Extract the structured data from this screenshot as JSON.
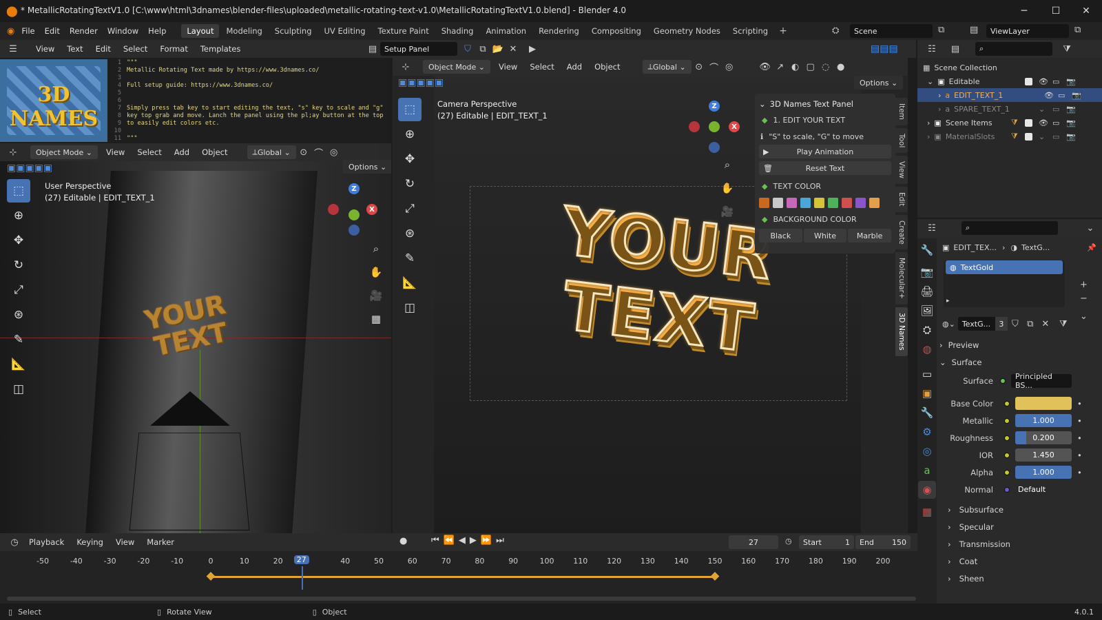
{
  "window": {
    "title": "* MetallicRotatingTextV1.0 [C:\\www\\html\\3dnames\\blender-files\\uploaded\\metallic-rotating-text-v1.0\\MetallicRotatingTextV1.0.blend] - Blender 4.0"
  },
  "menu": [
    "File",
    "Edit",
    "Render",
    "Window",
    "Help"
  ],
  "workspaces": [
    "Layout",
    "Modeling",
    "Sculpting",
    "UV Editing",
    "Texture Paint",
    "Shading",
    "Animation",
    "Rendering",
    "Compositing",
    "Geometry Nodes",
    "Scripting"
  ],
  "active_workspace": "Layout",
  "scene": {
    "name": "Scene",
    "view_layer": "ViewLayer"
  },
  "text_editor": {
    "menus": [
      "View",
      "Text",
      "Edit",
      "Select",
      "Format",
      "Templates"
    ],
    "file": "Setup Panel",
    "lines": [
      {
        "n": "1",
        "t": "\"\"\""
      },
      {
        "n": "2",
        "t": "Metallic Rotating Text made by https://www.3dnames.co/"
      },
      {
        "n": "3",
        "t": ""
      },
      {
        "n": "4",
        "t": "Full setup guide: https://www.3dnames.co/"
      },
      {
        "n": "5",
        "t": ""
      },
      {
        "n": "6",
        "t": ""
      },
      {
        "n": "7",
        "t": "Simply press tab key to start editing the text, \"s\" key to scale and \"g\""
      },
      {
        "n": "8",
        "t": "key top grab and move. Lanch the panel using the pl;ay button at the top"
      },
      {
        "n": "9",
        "t": "to easily edit colors etc."
      },
      {
        "n": "10",
        "t": ""
      },
      {
        "n": "11",
        "t": "\"\"\""
      }
    ],
    "logo_text": "3D NAMES"
  },
  "viewport_left": {
    "mode": "Object Mode",
    "menus": [
      "View",
      "Select",
      "Add",
      "Object"
    ],
    "orientation": "Global",
    "options": "Options",
    "perspective": "User Perspective",
    "info": "(27) Editable | EDIT_TEXT_1"
  },
  "viewport_right": {
    "mode": "Object Mode",
    "menus": [
      "View",
      "Select",
      "Add",
      "Object"
    ],
    "orientation": "Global",
    "options": "Options",
    "perspective": "Camera Perspective",
    "info": "(27) Editable | EDIT_TEXT_1",
    "render_text": "YOUR TEXT",
    "sidebar_tabs": [
      "Item",
      "Tool",
      "View",
      "Edit",
      "Create",
      "Molecular+",
      "3D Names"
    ]
  },
  "panel": {
    "title": "3D Names Text Panel",
    "step1": "1. EDIT YOUR TEXT",
    "hint": "\"S\" to scale, \"G\" to move",
    "play": "Play Animation",
    "reset": "Reset Text",
    "text_color": "TEXT COLOR",
    "swatches": [
      "#c8691e",
      "#c9c9c9",
      "#c767b8",
      "#4aa6d6",
      "#d6c23a",
      "#4fb25a",
      "#d0504f",
      "#8a55c9",
      "#e3a04a"
    ],
    "bg_color": "BACKGROUND COLOR",
    "bg_options": [
      "Black",
      "White",
      "Marble"
    ]
  },
  "outliner": {
    "root": "Scene Collection",
    "items": [
      {
        "label": "Editable",
        "kind": "collection"
      },
      {
        "label": "EDIT_TEXT_1",
        "kind": "text-object"
      },
      {
        "label": "SPARE_TEXT_1",
        "kind": "text-object"
      },
      {
        "label": "Scene Items",
        "kind": "collection"
      },
      {
        "label": "MaterialSlots",
        "kind": "collection"
      }
    ]
  },
  "properties": {
    "breadcrumb_obj": "EDIT_TEX...",
    "breadcrumb_mat": "TextG...",
    "material_slot": "TextGold",
    "material_name": "TextG...",
    "users": "3",
    "preview": "Preview",
    "surface_section": "Surface",
    "surface_label": "Surface",
    "surface_value": "Principled BS...",
    "rows": [
      {
        "label": "Base Color",
        "value": "",
        "kind": "color",
        "color": "#e0c15a"
      },
      {
        "label": "Metallic",
        "value": "1.000",
        "fill": 1.0
      },
      {
        "label": "Roughness",
        "value": "0.200",
        "fill": 0.2
      },
      {
        "label": "IOR",
        "value": "1.450",
        "fill": 0.0
      },
      {
        "label": "Alpha",
        "value": "1.000",
        "fill": 1.0
      },
      {
        "label": "Normal",
        "value": "Default",
        "kind": "link"
      }
    ],
    "sections": [
      "Subsurface",
      "Specular",
      "Transmission",
      "Coat",
      "Sheen"
    ]
  },
  "timeline": {
    "menus": [
      "Playback",
      "Keying",
      "View",
      "Marker"
    ],
    "current_frame": "27",
    "start_label": "Start",
    "start": "1",
    "end_label": "End",
    "end": "150",
    "ticks": [
      {
        "v": -50,
        "label": "-50"
      },
      {
        "v": -40,
        "label": "-40"
      },
      {
        "v": -30,
        "label": "-30"
      },
      {
        "v": -20,
        "label": "-20"
      },
      {
        "v": -10,
        "label": "-10"
      },
      {
        "v": 0,
        "label": "0"
      },
      {
        "v": 10,
        "label": "10"
      },
      {
        "v": 20,
        "label": "20"
      },
      {
        "v": 40,
        "label": "40"
      },
      {
        "v": 50,
        "label": "50"
      },
      {
        "v": 60,
        "label": "60"
      },
      {
        "v": 70,
        "label": "70"
      },
      {
        "v": 80,
        "label": "80"
      },
      {
        "v": 90,
        "label": "90"
      },
      {
        "v": 100,
        "label": "100"
      },
      {
        "v": 110,
        "label": "110"
      },
      {
        "v": 120,
        "label": "120"
      },
      {
        "v": 130,
        "label": "130"
      },
      {
        "v": 140,
        "label": "140"
      },
      {
        "v": 150,
        "label": "150"
      },
      {
        "v": 160,
        "label": "160"
      },
      {
        "v": 170,
        "label": "170"
      },
      {
        "v": 180,
        "label": "180"
      },
      {
        "v": 190,
        "label": "190"
      },
      {
        "v": 200,
        "label": "200"
      }
    ],
    "keyframes": [
      0,
      150
    ],
    "playhead": 27
  },
  "statusbar": {
    "select": "Select",
    "rotate": "Rotate View",
    "object": "Object",
    "version": "4.0.1"
  },
  "colors": {
    "accent": "#4772b3",
    "gold": "#d9a53a",
    "keyframe": "#e3a436"
  }
}
